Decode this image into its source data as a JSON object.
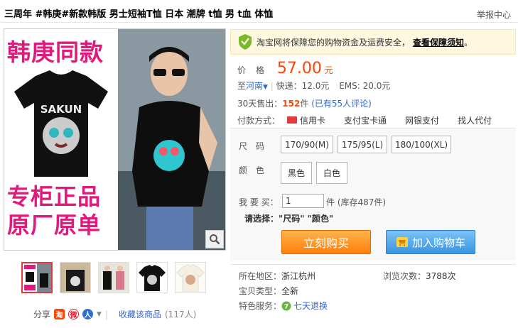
{
  "title": "三周年 #韩庚#新款韩版 男士短袖T恤 日本 潮牌 t恤 男 t血 体恤",
  "report": "举报中心",
  "image": {
    "promo_top": "韩庚同款",
    "promo_bottom_line1": "专柜正品",
    "promo_bottom_line2": "原厂原单",
    "shirt_print": "SAKUN"
  },
  "share": {
    "label": "分享",
    "favorite": "收藏该商品",
    "favorite_count": "(117人)"
  },
  "guarantee": {
    "text": "淘宝网将保障您的购物资金及运费安全，",
    "link": "查看保障须知",
    "end": "。"
  },
  "price": {
    "label": "价格",
    "value": "57.00",
    "unit": "元"
  },
  "shipping": {
    "prefix": "至",
    "region": "河南",
    "express": "快递：12.0元",
    "ems": "EMS: 20.0元"
  },
  "sales": {
    "label": "30天售出：",
    "count": "152",
    "unit": "件",
    "reviews": "(已有55人评论)"
  },
  "payment": {
    "label": "付款方式：",
    "methods": [
      "信用卡",
      "支付宝卡通",
      "网银支付",
      "找人代付"
    ]
  },
  "sku": {
    "size_label": "尺　码",
    "sizes": [
      "170/90(M)",
      "175/95(L)",
      "180/100(XL)"
    ],
    "color_label": "颜　色",
    "colors": [
      "黑色",
      "白色"
    ],
    "qty_label": "我 要 买：",
    "qty_value": "1",
    "stock": "件 (库存487件)",
    "prompt": "请选择：\"尺码\" \"颜色\"",
    "buy_button": "立刻购买",
    "cart_button": "加入购物车"
  },
  "meta": {
    "location_label": "所在地区：",
    "location": "浙江杭州",
    "views_label": "浏览次数：",
    "views": "3788次",
    "type_label": "宝贝类型：",
    "type": "全新",
    "service_label": "特色服务：",
    "service": "七天退换"
  },
  "colors": {
    "accent_price": "#ff4400",
    "link": "#3366cc",
    "promo_pink": "#e2197c",
    "buy_orange": "#ff7e0c",
    "cart_blue": "#3a95e0"
  }
}
